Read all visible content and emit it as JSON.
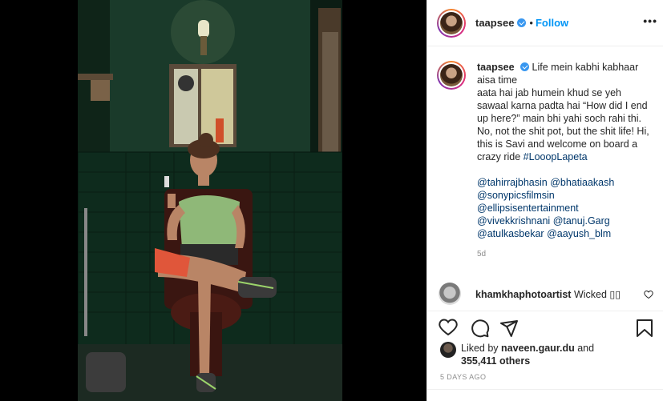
{
  "post": {
    "username": "taapsee",
    "follow_label": "Follow",
    "separator": "•",
    "more_label": "•••"
  },
  "caption": {
    "username": "taapsee",
    "line1": "Life mein kabhi kabhaar aisa time",
    "line2": "aata hai jab humein khud se yeh sawaal karna padta hai “How did I end up here?” main bhi yahi soch rahi thi. No, not the shit pot, but the shit life! Hi, this is Savi and welcome on board a crazy ride",
    "hashtag": "#LooopLapeta",
    "mentions_line1a": "@tahirrajbhasin",
    "mentions_line1b": "@bhatiaakash",
    "mentions_line2": "@sonypicsfilmsin",
    "mentions_line3": "@ellipsisentertainment",
    "mentions_line4a": "@vivekkrishnani",
    "mentions_line4b": "@tanuj.Garg",
    "mentions_line5a": "@atulkasbekar",
    "mentions_line5b": "@aayush_blm",
    "time_ago": "5d"
  },
  "comment": {
    "username": "khamkhaphotoartist",
    "text": "Wicked ▯▯"
  },
  "likes": {
    "prefix": "Liked by",
    "liker": "naveen.gaur.du",
    "and": "and",
    "count": "355,411 others"
  },
  "date": "5 DAYS AGO",
  "icons": {
    "like": "heart-icon",
    "comment": "comment-icon",
    "share": "paper-plane-icon",
    "save": "bookmark-icon",
    "options": "more-options-icon",
    "verified": "verified-badge-icon",
    "comment_like": "small-heart-icon"
  },
  "colors": {
    "accent": "#0095f6",
    "verified": "#3897f0",
    "link": "#00376b",
    "muted": "#8e8e8e"
  }
}
